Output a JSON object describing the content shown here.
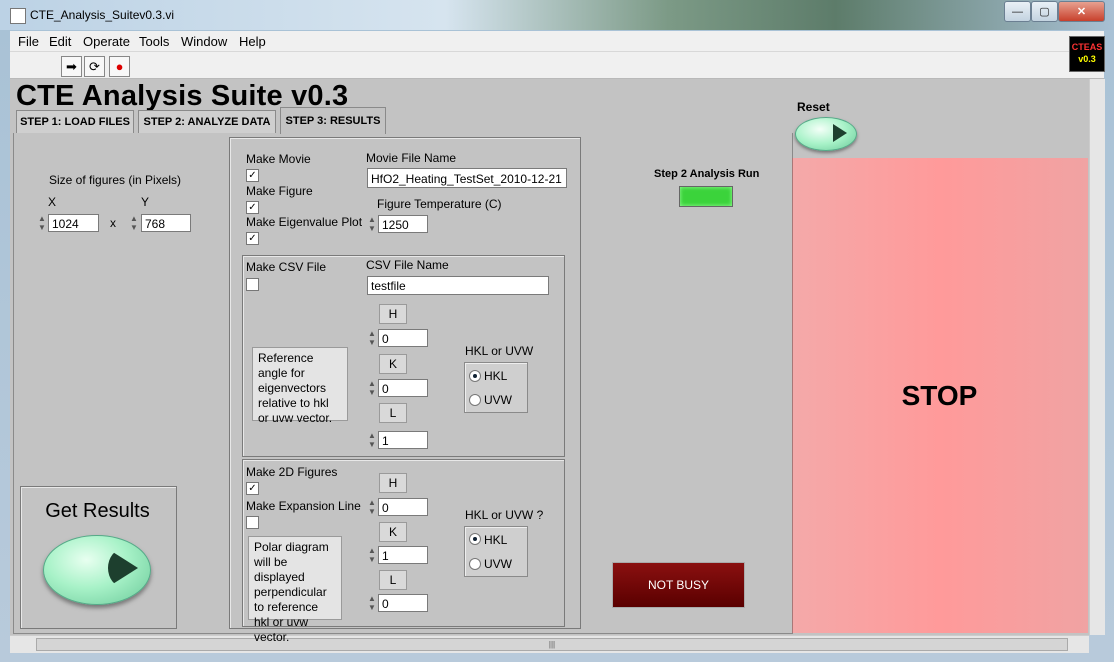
{
  "window": {
    "title": "CTE_Analysis_Suitev0.3.vi",
    "min": "—",
    "max": "▢",
    "close": "✕"
  },
  "menu": [
    "File",
    "Edit",
    "Operate",
    "Tools",
    "Window",
    "Help"
  ],
  "toolbar": {
    "run": "➡",
    "run_cont": "⟳",
    "abort": "●"
  },
  "logo": {
    "line1": "CTEAS",
    "line2": "v0.3"
  },
  "app_title": "CTE Analysis Suite v0.3",
  "tabs": [
    "STEP 1: LOAD FILES",
    "STEP 2: ANALYZE DATA",
    "STEP 3: RESULTS"
  ],
  "active_tab": 2,
  "figure_size": {
    "label": "Size of figures (in Pixels)",
    "x_label": "X",
    "x_value": "1024",
    "sep": "x",
    "y_label": "Y",
    "y_value": "768"
  },
  "get_results": {
    "label": "Get Results"
  },
  "movie": {
    "make_movie": "Make Movie",
    "make_figure": "Make Figure",
    "make_eigen": "Make Eigenvalue Plot",
    "movie_file_label": "Movie File Name",
    "movie_file_value": "HfO2_Heating_TestSet_2010-12-21",
    "temp_label": "Figure Temperature (C)",
    "temp_value": "1250"
  },
  "csv": {
    "make_csv": "Make CSV File",
    "csv_label": "CSV File Name",
    "csv_value": "testfile",
    "note": "Reference angle for eigenvectors relative to hkl or uvw vector.",
    "h": "H",
    "h_val": "0",
    "k": "K",
    "k_val": "0",
    "l": "L",
    "l_val": "1",
    "mode_label": "HKL or UVW",
    "opt1": "HKL",
    "opt2": "UVW"
  },
  "polar": {
    "make_2d": "Make 2D Figures",
    "make_exp": "Make Expansion Line",
    "note": "Polar diagram will be displayed perpendicular to reference hkl or uvw vector.",
    "h": "H",
    "h_val": "0",
    "k": "K",
    "k_val": "1",
    "l": "L",
    "l_val": "0",
    "mode_label": "HKL or UVW ?",
    "opt1": "HKL",
    "opt2": "UVW"
  },
  "status": {
    "step2_label": "Step 2 Analysis Run",
    "led_color": "#3bd33b",
    "busy": "NOT BUSY"
  },
  "reset": {
    "label": "Reset"
  },
  "stop": {
    "label": "STOP"
  },
  "hscroll": {
    "grip": "|||"
  }
}
